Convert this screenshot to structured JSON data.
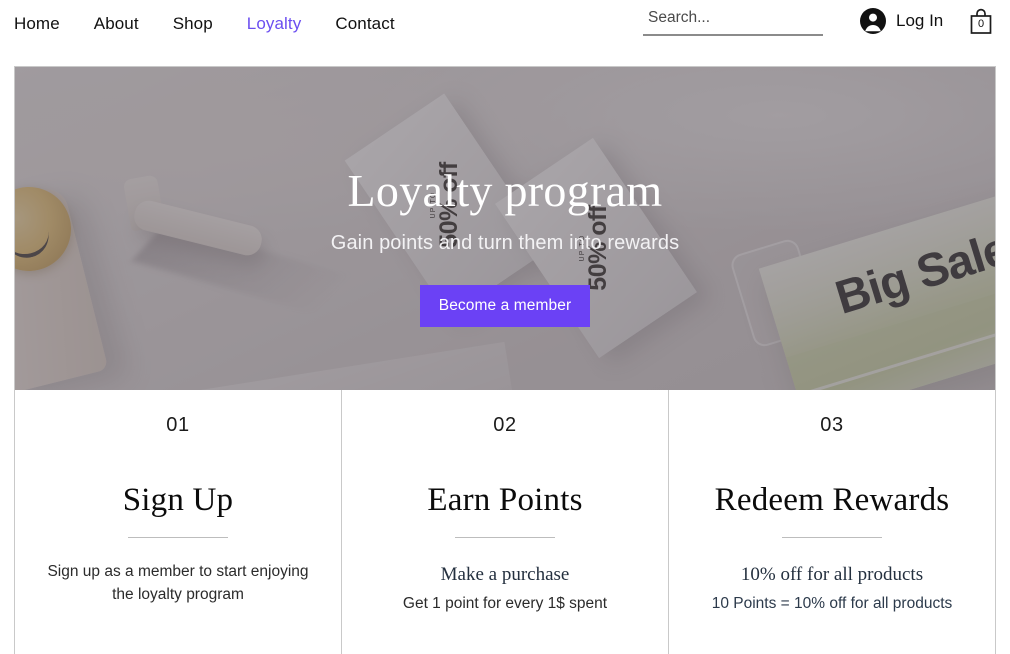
{
  "header": {
    "nav": [
      {
        "label": "Home",
        "active": false
      },
      {
        "label": "About",
        "active": false
      },
      {
        "label": "Shop",
        "active": false
      },
      {
        "label": "Loyalty",
        "active": true
      },
      {
        "label": "Contact",
        "active": false
      }
    ],
    "search": {
      "placeholder": "Search...",
      "value": "",
      "icon": "search-icon"
    },
    "account": {
      "label": "Log In",
      "icon": "user-avatar-icon"
    },
    "cart": {
      "count": "0",
      "icon": "shopping-bag-icon"
    },
    "accent_color": "#6b4ef0"
  },
  "hero": {
    "title": "Loyalty program",
    "subtitle": "Gain points and turn them into rewards",
    "cta_label": "Become a member",
    "cta_color": "#6b41f5",
    "overlay_color": "rgba(104,97,103,0.56)",
    "photo_labels": {
      "packet_upto": "UP TO",
      "packet_off": "50% off",
      "box_text": "Big Sale"
    }
  },
  "steps": [
    {
      "number": "01",
      "title": "Sign Up",
      "lead": "",
      "body": "Sign up as a member to start enjoying the loyalty program"
    },
    {
      "number": "02",
      "title": "Earn Points",
      "lead": "Make a purchase",
      "body": "Get 1 point for every 1$ spent"
    },
    {
      "number": "03",
      "title": "Redeem Rewards",
      "lead": "10% off for all products",
      "body": "10 Points = 10% off for all products"
    }
  ]
}
